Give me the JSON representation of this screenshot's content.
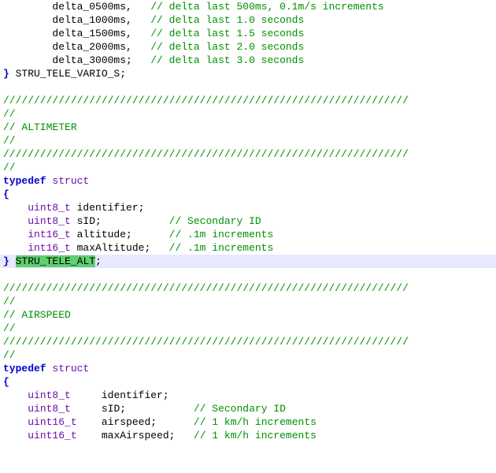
{
  "chart_data": null,
  "code": {
    "indent_field": "    ",
    "member_indent": "    ",
    "lines": [
      {
        "kind": "member_c",
        "name": "delta_0500ms,",
        "pad": "   ",
        "comment": "// delta last 500ms, 0.1m/s increments"
      },
      {
        "kind": "member_c",
        "name": "delta_1000ms,",
        "pad": "   ",
        "comment": "// delta last 1.0 seconds"
      },
      {
        "kind": "member_c",
        "name": "delta_1500ms,",
        "pad": "   ",
        "comment": "// delta last 1.5 seconds"
      },
      {
        "kind": "member_c",
        "name": "delta_2000ms,",
        "pad": "   ",
        "comment": "// delta last 2.0 seconds"
      },
      {
        "kind": "member_c",
        "name": "delta_3000ms;",
        "pad": "   ",
        "comment": "// delta last 3.0 seconds"
      },
      {
        "kind": "close",
        "text": "} STRU_TELE_VARIO_S;"
      },
      {
        "kind": "blank"
      },
      {
        "kind": "cmt",
        "text": "//////////////////////////////////////////////////////////////////"
      },
      {
        "kind": "cmt",
        "text": "//"
      },
      {
        "kind": "cmt",
        "text": "// ALTIMETER"
      },
      {
        "kind": "cmt",
        "text": "//"
      },
      {
        "kind": "cmt",
        "text": "//////////////////////////////////////////////////////////////////"
      },
      {
        "kind": "cmt",
        "text": "//"
      },
      {
        "kind": "typedef",
        "kw": "typedef",
        "type": "struct"
      },
      {
        "kind": "brace",
        "text": "{"
      },
      {
        "kind": "field",
        "type": "uint8_t",
        "name": " identifier;"
      },
      {
        "kind": "field_c",
        "type": "uint8_t",
        "name": " sID;           ",
        "comment": "// Secondary ID"
      },
      {
        "kind": "field_c",
        "type": "int16_t",
        "name": " altitude;      ",
        "comment": "// .1m increments"
      },
      {
        "kind": "field_c",
        "type": "int16_t",
        "name": " maxAltitude;   ",
        "comment": "// .1m increments"
      },
      {
        "kind": "close_hl",
        "pre": "} ",
        "hl": "STRU_TELE_ALT",
        "post": ";"
      },
      {
        "kind": "blank"
      },
      {
        "kind": "cmt",
        "text": "//////////////////////////////////////////////////////////////////"
      },
      {
        "kind": "cmt",
        "text": "//"
      },
      {
        "kind": "cmt",
        "text": "// AIRSPEED"
      },
      {
        "kind": "cmt",
        "text": "//"
      },
      {
        "kind": "cmt",
        "text": "//////////////////////////////////////////////////////////////////"
      },
      {
        "kind": "cmt",
        "text": "//"
      },
      {
        "kind": "typedef",
        "kw": "typedef",
        "type": "struct"
      },
      {
        "kind": "brace",
        "text": "{"
      },
      {
        "kind": "field2",
        "type": "uint8_t",
        "pad": "     ",
        "name": "identifier;"
      },
      {
        "kind": "field2_c",
        "type": "uint8_t",
        "pad": "     ",
        "name": "sID;           ",
        "comment": "// Secondary ID"
      },
      {
        "kind": "field2_c",
        "type": "uint16_t",
        "pad": "    ",
        "name": "airspeed;      ",
        "comment": "// 1 km/h increments"
      },
      {
        "kind": "field2_c",
        "type": "uint16_t",
        "pad": "    ",
        "name": "maxAirspeed;   ",
        "comment": "// 1 km/h increments"
      }
    ]
  }
}
